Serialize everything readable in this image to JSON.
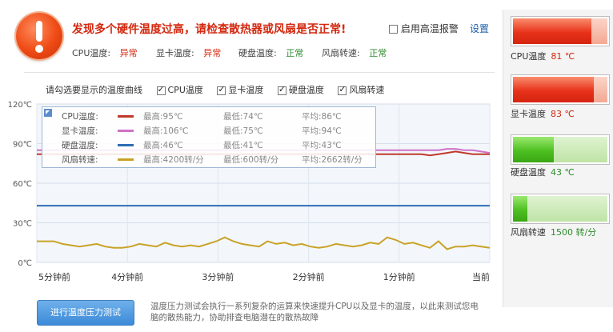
{
  "alert": {
    "title": "发现多个硬件温度过高，请检查散热器或风扇是否正常!",
    "high_temp_alarm_label": "启用高温报警",
    "settings_label": "设置"
  },
  "status": [
    {
      "label": "CPU温度:",
      "value": "异常",
      "state": "bad"
    },
    {
      "label": "显卡温度:",
      "value": "异常",
      "state": "bad"
    },
    {
      "label": "硬盘温度:",
      "value": "正常",
      "state": "ok"
    },
    {
      "label": "风扇转速:",
      "value": "正常",
      "state": "ok"
    }
  ],
  "curve_select": {
    "prompt": "请勾选要显示的温度曲线",
    "options": [
      {
        "label": "CPU温度",
        "checked": true
      },
      {
        "label": "显卡温度",
        "checked": true
      },
      {
        "label": "硬盘温度",
        "checked": true
      },
      {
        "label": "风扇转速",
        "checked": true
      }
    ]
  },
  "legend": [
    {
      "name": "CPU温度:",
      "color": "#c0392b",
      "max": "最高:95℃",
      "min": "最低:74℃",
      "avg": "平均:86℃"
    },
    {
      "name": "显卡温度:",
      "color": "#d071c8",
      "max": "最高:106℃",
      "min": "最低:75℃",
      "avg": "平均:94℃"
    },
    {
      "name": "硬盘温度:",
      "color": "#2f6db5",
      "max": "最高:46℃",
      "min": "最低:41℃",
      "avg": "平均:43℃"
    },
    {
      "name": "风扇转速:",
      "color": "#c9a227",
      "max": "最高:4200转/分",
      "min": "最低:600转/分",
      "avg": "平均:2662转/分"
    }
  ],
  "chart_data": {
    "type": "line",
    "y_ticks": [
      "120℃",
      "90℃",
      "60℃",
      "30℃",
      "0℃"
    ],
    "ylim": [
      0,
      120
    ],
    "x_ticks": [
      "5分钟前",
      "4分钟前",
      "3分钟前",
      "2分钟前",
      "1分钟前",
      "当前"
    ],
    "grid": true,
    "series": [
      {
        "name": "CPU温度",
        "color": "#c0392b",
        "values": [
          82,
          82,
          82,
          82,
          82,
          82,
          82,
          82,
          82,
          82,
          82,
          82,
          82,
          82,
          82,
          82,
          82,
          82,
          82,
          82,
          82,
          82,
          82,
          82,
          82,
          82,
          82,
          82,
          82,
          82,
          82,
          82,
          82,
          82,
          82,
          82,
          82,
          82,
          82,
          82,
          82,
          82,
          82,
          82,
          82,
          82,
          81,
          82,
          83,
          84,
          83,
          82,
          82,
          82
        ]
      },
      {
        "name": "显卡温度",
        "color": "#d071c8",
        "values": [
          85,
          85,
          85,
          85,
          85,
          85,
          85,
          85,
          85,
          85,
          85,
          85,
          85,
          85,
          85,
          85,
          85,
          85,
          85,
          85,
          85,
          85,
          85,
          85,
          85,
          85,
          85,
          85,
          85,
          85,
          85,
          85,
          85,
          85,
          85,
          85,
          85,
          85,
          85,
          85,
          85,
          85,
          85,
          85,
          85,
          85,
          85,
          85,
          86,
          86,
          85,
          85,
          84,
          83
        ]
      },
      {
        "name": "硬盘温度",
        "color": "#2f6db5",
        "values": [
          43,
          43,
          43,
          43,
          43,
          43,
          43,
          43,
          43,
          43,
          43,
          43,
          43,
          43,
          43,
          43,
          43,
          43,
          43,
          43,
          43,
          43,
          43,
          43,
          43,
          43,
          43,
          43,
          43,
          43,
          43,
          43,
          43,
          43,
          43,
          43,
          43,
          43,
          43,
          43,
          43,
          43,
          43,
          43,
          43,
          43,
          43,
          43,
          43,
          43,
          43,
          43,
          43,
          43
        ]
      },
      {
        "name": "风扇转速",
        "color": "#c9a227",
        "values": [
          16,
          16,
          16,
          14,
          13,
          12,
          13,
          14,
          12,
          11,
          11,
          12,
          14,
          13,
          12,
          15,
          13,
          12,
          13,
          12,
          14,
          16,
          19,
          16,
          14,
          13,
          12,
          16,
          14,
          15,
          13,
          14,
          12,
          11,
          12,
          14,
          13,
          12,
          13,
          15,
          14,
          19,
          17,
          14,
          15,
          13,
          11,
          16,
          10,
          12,
          12,
          13,
          12,
          11
        ]
      }
    ]
  },
  "stress_test": {
    "button_label": "进行温度压力测试",
    "description": "温度压力测试会执行一系列复杂的运算来快速提升CPU以及显卡的温度，以此来测试您电脑的散热能力，协助排查电脑潜在的散热故障"
  },
  "side_gauges": [
    {
      "label": "CPU温度",
      "value": "81 ℃",
      "fraction": 0.83,
      "color": "red",
      "value_color": "#d2280f"
    },
    {
      "label": "显卡温度",
      "value": "83 ℃",
      "fraction": 0.86,
      "color": "red",
      "value_color": "#d2280f"
    },
    {
      "label": "硬盘温度",
      "value": "43 ℃",
      "fraction": 0.43,
      "color": "green",
      "value_color": "#2e8b2e"
    },
    {
      "label": "风扇转速",
      "value": "1500 转/分",
      "fraction": 0.15,
      "color": "green",
      "value_color": "#2e8b2e"
    }
  ]
}
